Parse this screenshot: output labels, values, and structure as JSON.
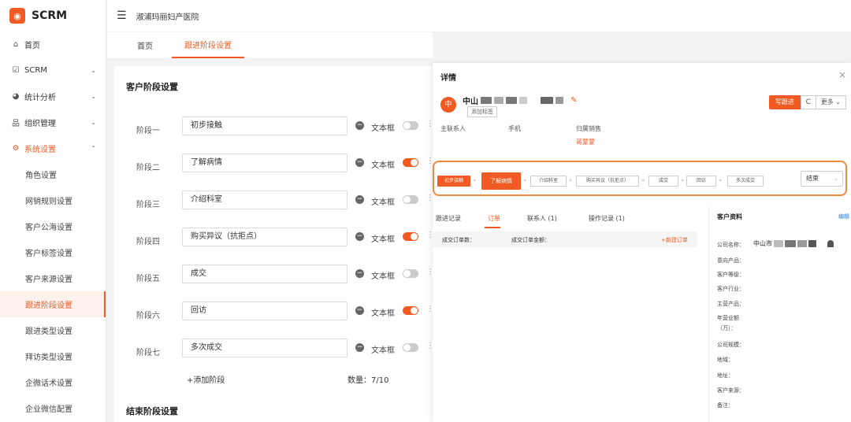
{
  "brand": {
    "name": "SCRM",
    "color": "#f15a22"
  },
  "header": {
    "hospital": "淑浦玛丽妇产医院"
  },
  "tabs": [
    {
      "label": "首页",
      "active": false
    },
    {
      "label": "跟进阶段设置",
      "active": true
    }
  ],
  "sidebar": {
    "items": [
      {
        "label": "首页",
        "icon": "home-icon",
        "glyph": "⌂",
        "chev": ""
      },
      {
        "label": "SCRM",
        "icon": "chart-icon",
        "glyph": "☑",
        "chev": "⌄"
      },
      {
        "label": "统计分析",
        "icon": "pie-icon",
        "glyph": "◕",
        "chev": "⌄"
      },
      {
        "label": "组织管理",
        "icon": "org-icon",
        "glyph": "品",
        "chev": "⌄"
      },
      {
        "label": "系统设置",
        "icon": "gear-icon",
        "glyph": "⚙",
        "chev": "⌃",
        "open": true
      }
    ],
    "sub_items": [
      {
        "label": "角色设置"
      },
      {
        "label": "网销规则设置"
      },
      {
        "label": "客户公海设置"
      },
      {
        "label": "客户标签设置"
      },
      {
        "label": "客户来源设置"
      },
      {
        "label": "跟进阶段设置",
        "active": true
      },
      {
        "label": "跟进类型设置"
      },
      {
        "label": "拜访类型设置"
      },
      {
        "label": "企微话术设置"
      },
      {
        "label": "企业微信配置"
      }
    ]
  },
  "stages_panel": {
    "title": "客户阶段设置",
    "kind_label": "文本框",
    "stages": [
      {
        "label": "阶段一",
        "value": "初步接触",
        "on": false
      },
      {
        "label": "阶段二",
        "value": "了解病情",
        "on": true
      },
      {
        "label": "阶段三",
        "value": "介绍科室",
        "on": false
      },
      {
        "label": "阶段四",
        "value": "购买异议（抗拒点）",
        "on": true
      },
      {
        "label": "阶段五",
        "value": "成交",
        "on": false
      },
      {
        "label": "阶段六",
        "value": "回访",
        "on": true
      },
      {
        "label": "阶段七",
        "value": "多次成交",
        "on": false
      }
    ],
    "add_label": "+添加阶段",
    "count_label": "数量：7/10",
    "end_title": "结束阶段设置"
  },
  "detail": {
    "title": "详情",
    "close": "×",
    "avatar": "中",
    "company_prefix": "中山",
    "add_tag": "添加标签",
    "write_followup": "写跟进",
    "refresh": "C",
    "more": "更多 ⌄",
    "info_labels": [
      "主联系人",
      "手机",
      "归属销售"
    ],
    "sales_name": "蒋蒙蒙",
    "pipeline": [
      "初步接触",
      "了解病情",
      "介绍科室",
      "购买异议（抗拒点）",
      "成交",
      "回访",
      "多次成交"
    ],
    "pipeline_done": 1,
    "pipeline_current": 1,
    "end_select": "结束",
    "tabs": [
      "跟进记录",
      "订单",
      "联系人 (1)",
      "操作记录 (1)"
    ],
    "active_tab": 1,
    "order_row": {
      "count_label": "成交订单数：",
      "amount_label": "成交订单金额：",
      "new_order": "+新建订单"
    },
    "profile": {
      "title": "客户资料",
      "edit": "编辑",
      "company_label": "公司名称：",
      "company_value": "中山市",
      "fields": [
        "意向产品：",
        "客户等级：",
        "客户行业：",
        "主营产品：",
        "年营业额",
        "（万）：",
        "公司规模：",
        "地域：",
        "地址：",
        "客户来源：",
        "备注："
      ]
    }
  }
}
